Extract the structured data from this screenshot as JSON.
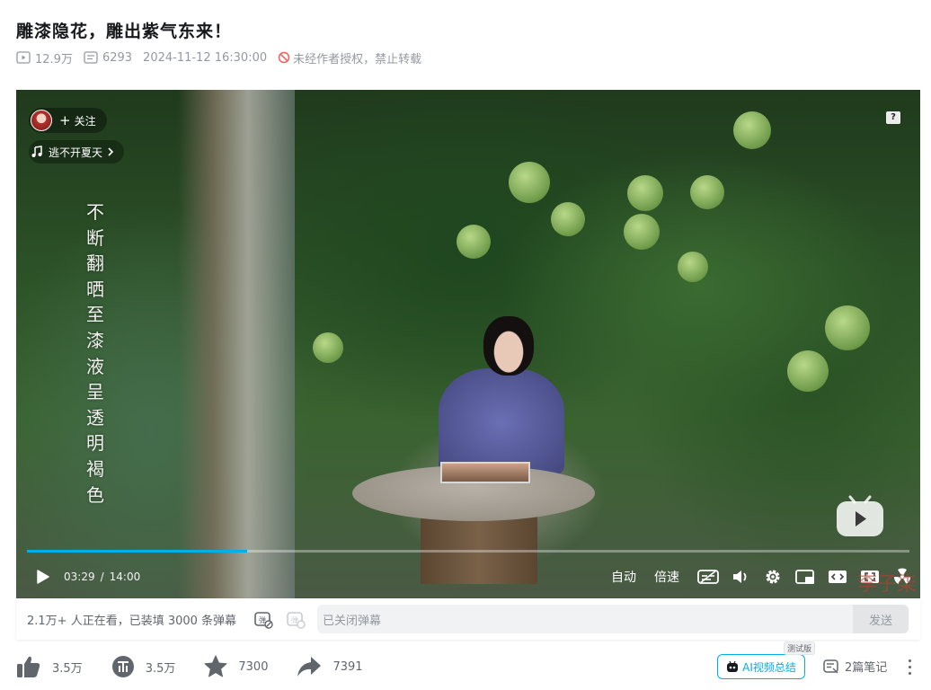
{
  "video": {
    "title": "雕漆隐花，雕出紫气东来！",
    "views": "12.9万",
    "danmaku_count": "6293",
    "publish_time": "2024-11-12 16:30:00",
    "copyright_notice": "未经作者授权，禁止转载"
  },
  "player": {
    "follow_label": "关注",
    "music_label": "逃不开夏天",
    "help_label": "?",
    "vertical_caption": [
      "不",
      "断",
      "翻",
      "晒",
      "至",
      "漆",
      "液",
      "呈",
      "透",
      "明",
      "褐",
      "色"
    ],
    "current_time": "03:29",
    "time_separator": "/",
    "duration": "14:00",
    "progress_fraction": 0.249,
    "buffered_fraction": 0.245,
    "quality_label": "自动",
    "speed_label": "倍速",
    "watermark": "李子柒",
    "accent_color": "#00aeec"
  },
  "danmaku": {
    "info": "2.1万+ 人正在看，已装填 3000 条弹幕",
    "input_placeholder": "已关闭弹幕",
    "send_label": "发送"
  },
  "actions": {
    "like": "3.5万",
    "coin": "3.5万",
    "favorite": "7300",
    "share": "7391",
    "ai_summary": "AI视频总结",
    "beta_badge": "测试版",
    "notes": "2篇笔记"
  }
}
